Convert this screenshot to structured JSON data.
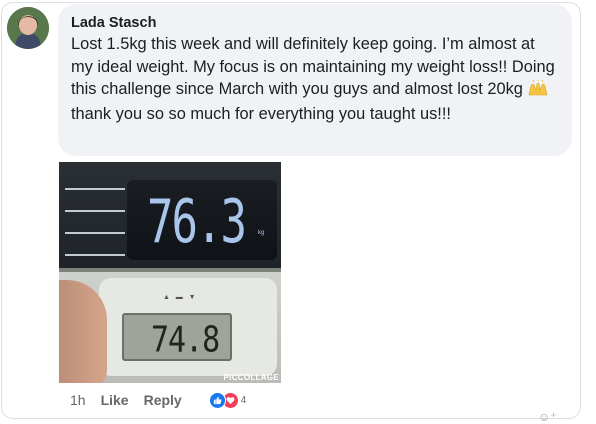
{
  "comment": {
    "author": "Lada Stasch",
    "text_before_emoji": "Lost 1.5kg this week and will definitely keep going. I’m almost at my ideal weight. My focus is on maintaining my weight loss!! Doing this challenge since March with you guys and almost lost 20kg",
    "emoji": "raised-hands-emoji",
    "text_after_emoji": "thank you so so much for everything you taught us!!!"
  },
  "photo": {
    "scale_reading_top": "76.3",
    "scale_unit_top": "kg",
    "scale_reading_bottom": "74.8",
    "watermark": "PICCOLLAGE"
  },
  "actions": {
    "time": "1h",
    "like_label": "Like",
    "reply_label": "Reply",
    "reaction_count": "4"
  },
  "colors": {
    "bubble": "#f0f2f5",
    "like_blue": "#1877f2",
    "love_red": "#f33e58",
    "meta_gray": "#65676b"
  }
}
